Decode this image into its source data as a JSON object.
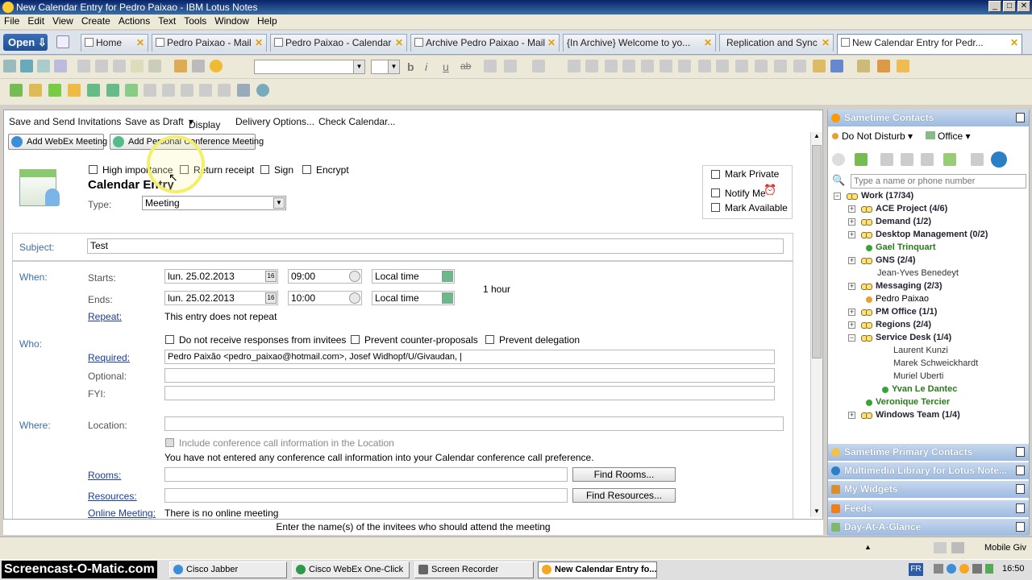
{
  "window": {
    "title": "New Calendar Entry for Pedro Paixao - IBM Lotus Notes"
  },
  "menu": [
    "File",
    "Edit",
    "View",
    "Create",
    "Actions",
    "Text",
    "Tools",
    "Window",
    "Help"
  ],
  "open_button": "Open",
  "tabs": [
    {
      "label": "Home"
    },
    {
      "label": "Pedro Paixao - Mail"
    },
    {
      "label": "Pedro Paixao - Calendar"
    },
    {
      "label": "Archive Pedro Paixao - Mail"
    },
    {
      "label": "{In Archive}  Welcome to yo..."
    },
    {
      "label": "Replication and Sync"
    },
    {
      "label": "New Calendar Entry for Pedr..."
    }
  ],
  "actions": {
    "save_send": "Save and Send Invitations",
    "save_draft": "Save as Draft",
    "display": "Display",
    "delivery": "Delivery Options...",
    "check_calendar": "Check Calendar...",
    "add_webex": "Add WebEx Meeting",
    "add_conference": "Add Personal Conference Meeting"
  },
  "options": {
    "high_importance": "High importance",
    "return_receipt": "Return receipt",
    "sign": "Sign",
    "encrypt": "Encrypt",
    "mark_private": "Mark Private",
    "notify_me": "Notify Me",
    "mark_available": "Mark Available"
  },
  "entry": {
    "heading": "Calendar Entry",
    "type_label": "Type:",
    "type_value": "Meeting"
  },
  "subject": {
    "label": "Subject:",
    "value": "Test"
  },
  "when": {
    "label": "When:",
    "starts_label": "Starts:",
    "start_date": "lun. 25.02.2013",
    "start_time": "09:00",
    "start_zone": "Local time",
    "ends_label": "Ends:",
    "end_date": "lun. 25.02.2013",
    "end_time": "10:00",
    "end_zone": "Local time",
    "duration": "1 hour",
    "repeat_label": "Repeat:",
    "repeat_value": "This entry does not repeat",
    "date_picker_label": "16"
  },
  "who": {
    "label": "Who:",
    "no_responses": "Do not receive responses from invitees",
    "prevent_counter": "Prevent counter-proposals",
    "prevent_delegation": "Prevent delegation",
    "required_label": "Required:",
    "required_value": "Pedro Paixão <pedro_paixao@hotmail.com>, Josef Widhopf/U/Givaudan, |",
    "optional_label": "Optional:",
    "fyi_label": "FYI:"
  },
  "where": {
    "label": "Where:",
    "location_label": "Location:",
    "include_conf": "Include conference call information in the Location",
    "conf_notice": "You have not entered any conference call information into your Calendar conference call preference.",
    "rooms_label": "Rooms:",
    "find_rooms": "Find Rooms...",
    "resources_label": "Resources:",
    "find_resources": "Find Resources...",
    "online_label": "Online Meeting:",
    "online_value": "There is no online meeting"
  },
  "status_hint": "Enter the name(s) of the invitees who should attend the meeting",
  "sidebar": {
    "sametime_title": "Sametime Contacts",
    "status": "Do Not Disturb",
    "location": "Office",
    "search_placeholder": "Type a name or phone number",
    "tree": [
      {
        "label": "Work (17/34)",
        "kind": "group",
        "level": 0,
        "expanded": true
      },
      {
        "label": "ACE Project (4/6)",
        "kind": "group",
        "level": 1
      },
      {
        "label": "Demand (1/2)",
        "kind": "group",
        "level": 1
      },
      {
        "label": "Desktop Management (0/2)",
        "kind": "group",
        "level": 1
      },
      {
        "label": "Gael Trinquart",
        "kind": "online",
        "level": 1
      },
      {
        "label": "GNS (2/4)",
        "kind": "group",
        "level": 1
      },
      {
        "label": "Jean-Yves Benedeyt",
        "kind": "offline",
        "level": 1
      },
      {
        "label": "Messaging (2/3)",
        "kind": "group",
        "level": 1
      },
      {
        "label": "Pedro Paixao",
        "kind": "dnd",
        "level": 1
      },
      {
        "label": "PM Office (1/1)",
        "kind": "group",
        "level": 1
      },
      {
        "label": "Regions (2/4)",
        "kind": "group",
        "level": 1
      },
      {
        "label": "Service Desk (1/4)",
        "kind": "group",
        "level": 1,
        "expanded": true
      },
      {
        "label": "Laurent Kunzi",
        "kind": "offline",
        "level": 2
      },
      {
        "label": "Marek Schweickhardt",
        "kind": "offline",
        "level": 2
      },
      {
        "label": "Muriel Uberti",
        "kind": "offline",
        "level": 2
      },
      {
        "label": "Yvan Le Dantec",
        "kind": "online",
        "level": 2
      },
      {
        "label": "Veronique Tercier",
        "kind": "online",
        "level": 1
      },
      {
        "label": "Windows Team (1/4)",
        "kind": "group",
        "level": 1
      }
    ],
    "panels": [
      "Sametime Primary Contacts",
      "Multimedia Library for Lotus Note...",
      "My Widgets",
      "Feeds",
      "Day-At-A-Glance"
    ]
  },
  "bottom_status": {
    "mobile": "Mobile Giv"
  },
  "taskbar": {
    "watermark": "Screencast-O-Matic.com",
    "items": [
      "Cisco Jabber",
      "Cisco WebEx One-Click",
      "Screen Recorder",
      "New Calendar Entry fo..."
    ],
    "lang": "FR",
    "clock": "16:50"
  },
  "colors": {
    "title_bar": "#0a246a",
    "section_label": "#3d6ea8",
    "link": "#1a3d9b",
    "online": "#3aa335",
    "sidebar_header": "#9ebbe0"
  }
}
